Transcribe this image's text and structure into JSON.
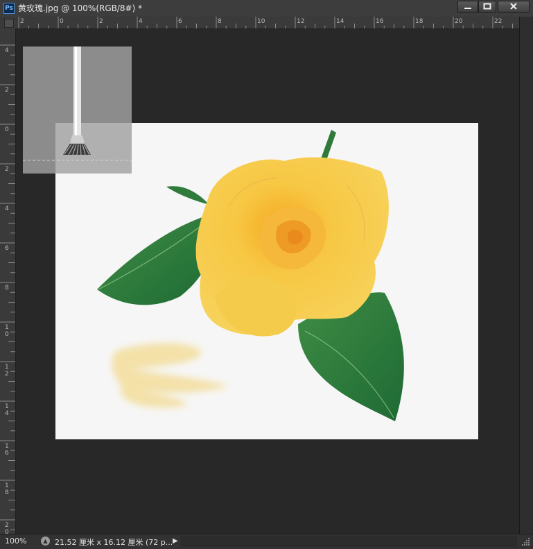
{
  "app": {
    "icon_label": "Ps"
  },
  "window": {
    "title": "黄玫瑰.jpg @ 100%(RGB/8#) *"
  },
  "controls": {
    "minimize": "minimize-icon",
    "maximize": "maximize-icon",
    "close": "close-icon"
  },
  "rulers": {
    "horizontal": [
      "2",
      "0",
      "2",
      "4",
      "6",
      "8",
      "10",
      "12",
      "14",
      "16",
      "18",
      "20",
      "22"
    ],
    "vertical": [
      "4",
      "2",
      "0",
      "2",
      "4",
      "6",
      "8",
      "10",
      "12",
      "14",
      "16",
      "18",
      "20"
    ]
  },
  "document": {
    "subject": "yellow rose with green leaves",
    "background": "#f6f6f6"
  },
  "tool": {
    "name": "brush-preview-icon"
  },
  "status": {
    "zoom": "100%",
    "doc_info": "21.52 厘米 x 16.12 厘米 (72 p..."
  },
  "colors": {
    "workspace": "#282828",
    "panel": "#3a3a3a",
    "rose": "#f5c842",
    "leaf": "#2f7a3a"
  }
}
